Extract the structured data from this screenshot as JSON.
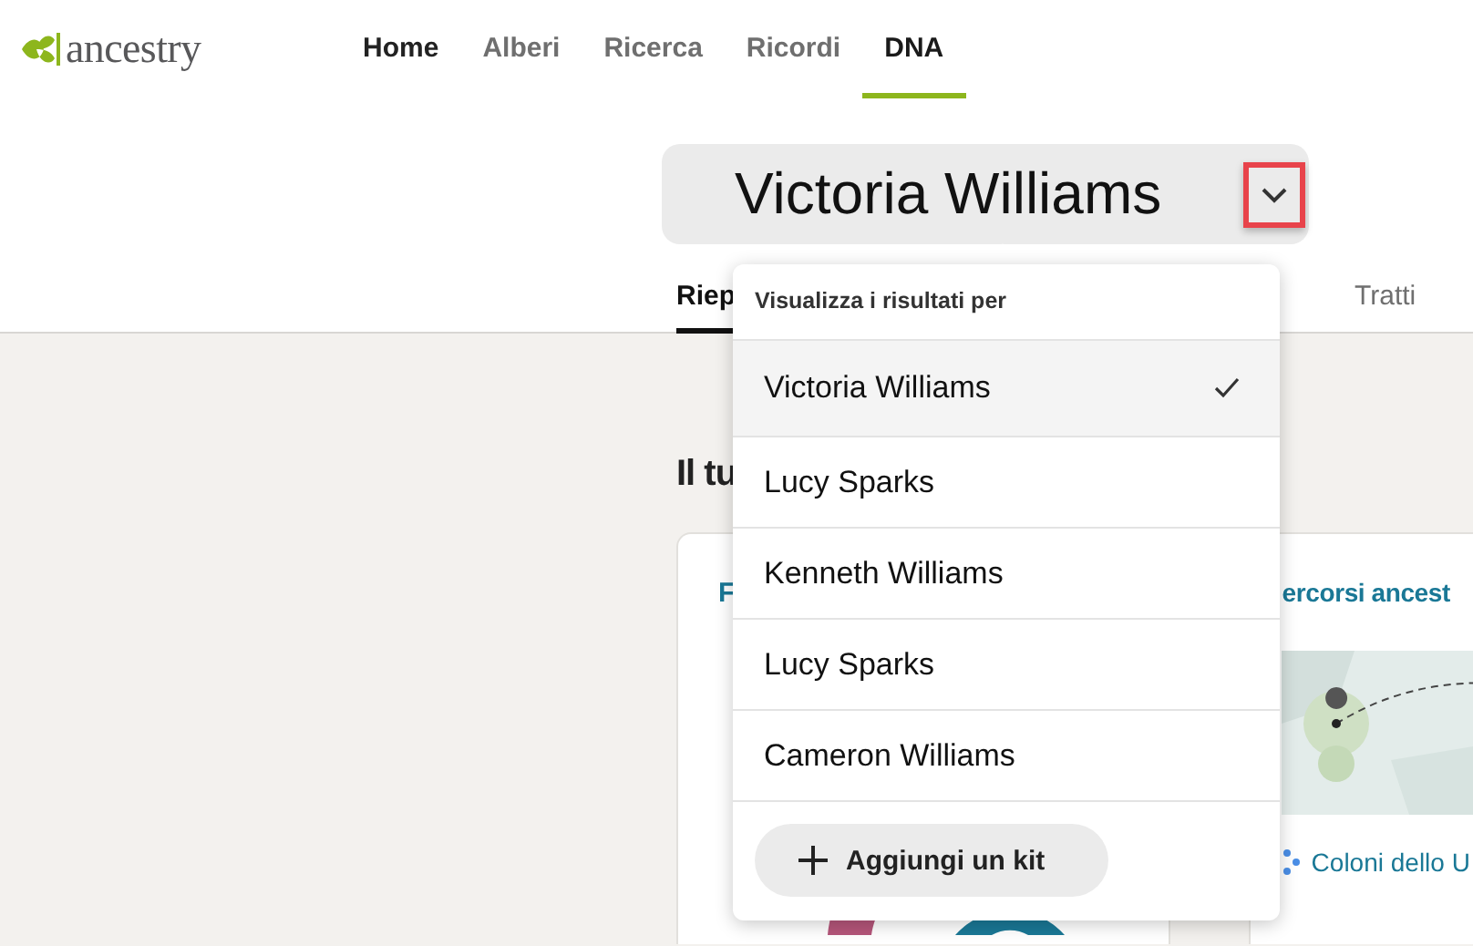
{
  "header": {
    "logo": "ancestry",
    "nav": [
      {
        "label": "Home",
        "selected": false,
        "highlighted": true
      },
      {
        "label": "Alberi",
        "selected": false,
        "highlighted": false
      },
      {
        "label": "Ricerca",
        "selected": false,
        "highlighted": false
      },
      {
        "label": "Ricordi",
        "selected": false,
        "highlighted": false
      },
      {
        "label": "DNA",
        "selected": true,
        "highlighted": false
      }
    ]
  },
  "selector": {
    "name": "Victoria Williams",
    "expanded": true
  },
  "tabs": [
    {
      "label": "Riep",
      "selected": true
    },
    {
      "label": "Tratti",
      "selected": false
    }
  ],
  "heading": "Il tu",
  "cards": [
    {
      "kind": "ethnicity",
      "title": "F"
    },
    {
      "kind": "journeys",
      "title": "ercorsi ancest",
      "link": "Coloni dello U"
    }
  ],
  "dropdown": {
    "heading": "Visualizza i risultati per",
    "items": [
      {
        "name": "Victoria Williams",
        "selected": true
      },
      {
        "name": "Lucy Sparks",
        "selected": false
      },
      {
        "name": "Kenneth Williams",
        "selected": false
      },
      {
        "name": "Lucy Sparks",
        "selected": false
      },
      {
        "name": "Cameron Williams",
        "selected": false
      }
    ],
    "add_button": "Aggiungi un kit"
  }
}
